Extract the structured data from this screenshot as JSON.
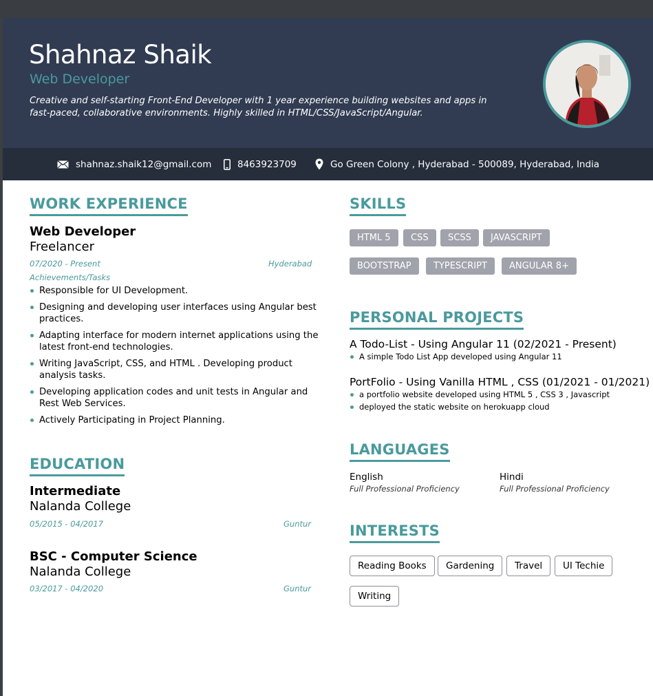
{
  "header": {
    "name": "Shahnaz Shaik",
    "role": "Web Developer",
    "summary": "Creative and self-starting Front-End Developer with 1 year experience building websites and apps in fast-paced, collaborative environments. Highly skilled in HTML/CSS/JavaScript/Angular."
  },
  "contact": {
    "email": "shahnaz.shaik12@gmail.com",
    "phone": "8463923709",
    "address": "Go Green Colony , Hyderabad - 500089, Hyderabad, India",
    "icons": [
      "email-icon",
      "phone-icon",
      "location-icon"
    ]
  },
  "work": {
    "heading": "WORK EXPERIENCE",
    "jobs": [
      {
        "title": "Web Developer",
        "org": "Freelancer",
        "dates": "07/2020 - Present",
        "location": "Hyderabad",
        "sublabel": "Achievements/Tasks",
        "items": [
          "Responsible for UI Development.",
          "Designing and developing user interfaces using Angular best practices.",
          "Adapting interface for modern internet applications using the latest front-end technologies.",
          "Writing JavaScript, CSS, and HTML . Developing product analysis tasks.",
          "Developing application codes and unit tests in Angular and Rest Web Services.",
          "Actively Participating in Project Planning."
        ]
      }
    ]
  },
  "education": {
    "heading": "EDUCATION",
    "entries": [
      {
        "degree": "Intermediate",
        "school": "Nalanda College",
        "dates": "05/2015 - 04/2017",
        "location": "Guntur"
      },
      {
        "degree": "BSC - Computer Science",
        "school": "Nalanda College",
        "dates": "03/2017 - 04/2020",
        "location": "Guntur"
      }
    ]
  },
  "skills": {
    "heading": "SKILLS",
    "items": [
      "HTML 5",
      "CSS",
      "SCSS",
      "JAVASCRIPT",
      "BOOTSTRAP",
      "TYPESCRIPT",
      "ANGULAR 8+"
    ]
  },
  "projects": {
    "heading": "PERSONAL PROJECTS",
    "items": [
      {
        "title": "A Todo-List - Using Angular 11 (02/2021 - Present)",
        "bullets": [
          "A simple Todo List App developed using Angular 11"
        ]
      },
      {
        "title": "PortFolio - Using Vanilla HTML , CSS (01/2021 - 01/2021)",
        "bullets": [
          "a portfolio website developed using HTML 5 , CSS 3 , Javascript",
          "deployed the static website on herokuapp cloud"
        ]
      }
    ]
  },
  "languages": {
    "heading": "LANGUAGES",
    "items": [
      {
        "name": "English",
        "level": "Full Professional Proficiency"
      },
      {
        "name": "Hindi",
        "level": "Full Professional Proficiency"
      }
    ]
  },
  "interests": {
    "heading": "INTERESTS",
    "items": [
      "Reading Books",
      "Gardening",
      "Travel",
      "UI Techie",
      "Writing"
    ]
  },
  "colors": {
    "header_bg": "#313c52",
    "contact_bg": "#262e3b",
    "accent": "#4a9a9c",
    "skill_chip": "#a0a3ab"
  }
}
